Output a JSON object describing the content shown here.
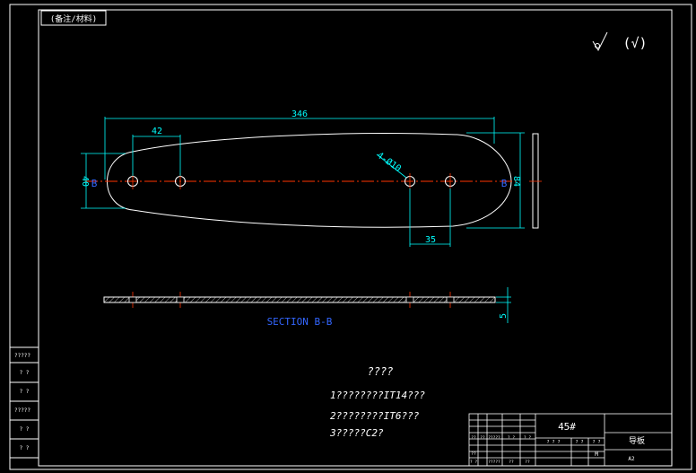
{
  "title_tag": "(备注/材料)",
  "roughness_label": "(√)",
  "dims": {
    "length": "346",
    "hole_spacing_left": "42",
    "hole_note": "4-Ø10",
    "hole_spacing_right": "35",
    "height_left": "40",
    "height_right": "84",
    "thickness": "5",
    "section_mark_left": "B",
    "section_mark_right": "B"
  },
  "section_label": "SECTION B-B",
  "notes": {
    "title": "????",
    "line1": "1????????IT14???",
    "line2": "2????????IT6???",
    "line3": "3?????C2?"
  },
  "left_strip": [
    "?????",
    "? ?",
    "? ?",
    "?????",
    "? ?",
    "? ?"
  ],
  "title_block": {
    "material": "45#",
    "part_name": "导板",
    "scale_label": "M",
    "sheet": "A2",
    "small_cells": [
      "??",
      "??",
      "?????",
      "? ?",
      "? ?",
      "? ?",
      "?????",
      "??",
      "??",
      "??",
      "? ? ?",
      "? ?",
      "? ?"
    ]
  },
  "colors": {
    "frame": "#ffffff",
    "dimension": "#00ffff",
    "centerline": "#ff3300",
    "text": "#ffffff",
    "section_label": "#3366ff",
    "outline_alt": "#00ff66"
  }
}
